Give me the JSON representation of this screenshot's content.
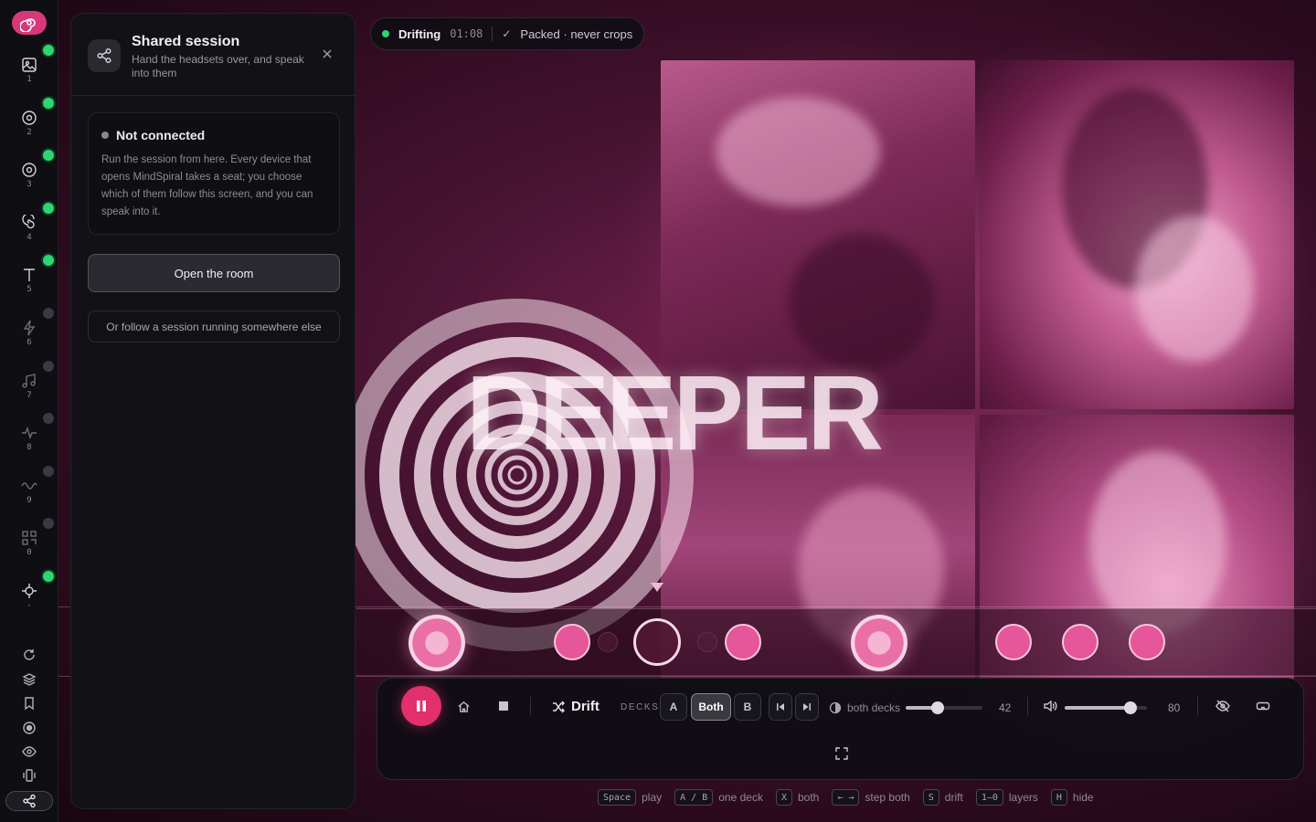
{
  "rail": {
    "items": [
      {
        "num": "1",
        "icon": "image-icon",
        "active": true
      },
      {
        "num": "2",
        "icon": "target-icon",
        "active": true
      },
      {
        "num": "3",
        "icon": "target-icon",
        "active": true
      },
      {
        "num": "4",
        "icon": "spiral-icon",
        "active": true
      },
      {
        "num": "5",
        "icon": "text-icon",
        "active": true
      },
      {
        "num": "6",
        "icon": "bolt-icon",
        "active": false
      },
      {
        "num": "7",
        "icon": "music-icon",
        "active": false
      },
      {
        "num": "8",
        "icon": "pulse-icon",
        "active": false
      },
      {
        "num": "9",
        "icon": "wave-icon",
        "active": false
      },
      {
        "num": "0",
        "icon": "grid-icon",
        "active": false
      },
      {
        "num": "-",
        "icon": "crosshair-icon",
        "active": true
      }
    ],
    "bottom_icons": [
      "refresh-icon",
      "layers-icon",
      "bookmark-icon",
      "record-icon",
      "eye-icon",
      "vibrate-icon",
      "share-icon"
    ]
  },
  "panel": {
    "title": "Shared session",
    "subtitle": "Hand the headsets over, and speak into them",
    "status_title": "Not connected",
    "status_text": "Run the session from here. Every device that opens MindSpiral takes a seat; you choose which of them follow this screen, and you can speak into it.",
    "primary_button": "Open the room",
    "secondary_button": "Or follow a session running somewhere else"
  },
  "top_pill": {
    "state": "Drifting",
    "time": "01:08",
    "layout": "Packed · never crops"
  },
  "stage": {
    "overlay_word": "DEEPER"
  },
  "transport": {
    "mode_label": "Drift",
    "decks_label": "DECKS",
    "deck_a": "A",
    "deck_both": "Both",
    "deck_b": "B",
    "scope_label": "both decks",
    "intensity_value": "42",
    "intensity": 42,
    "volume_value": "80",
    "volume": 80
  },
  "shortcuts": [
    {
      "key": "Space",
      "label": "play"
    },
    {
      "key": "A / B",
      "label": "one deck"
    },
    {
      "key": "X",
      "label": "both"
    },
    {
      "key": "← →",
      "label": "step both"
    },
    {
      "key": "S",
      "label": "drift"
    },
    {
      "key": "1–0",
      "label": "layers"
    },
    {
      "key": "H",
      "label": "hide"
    }
  ],
  "colors": {
    "accent": "#e1306c",
    "live": "#2ed573",
    "off": "#3b3a42"
  }
}
